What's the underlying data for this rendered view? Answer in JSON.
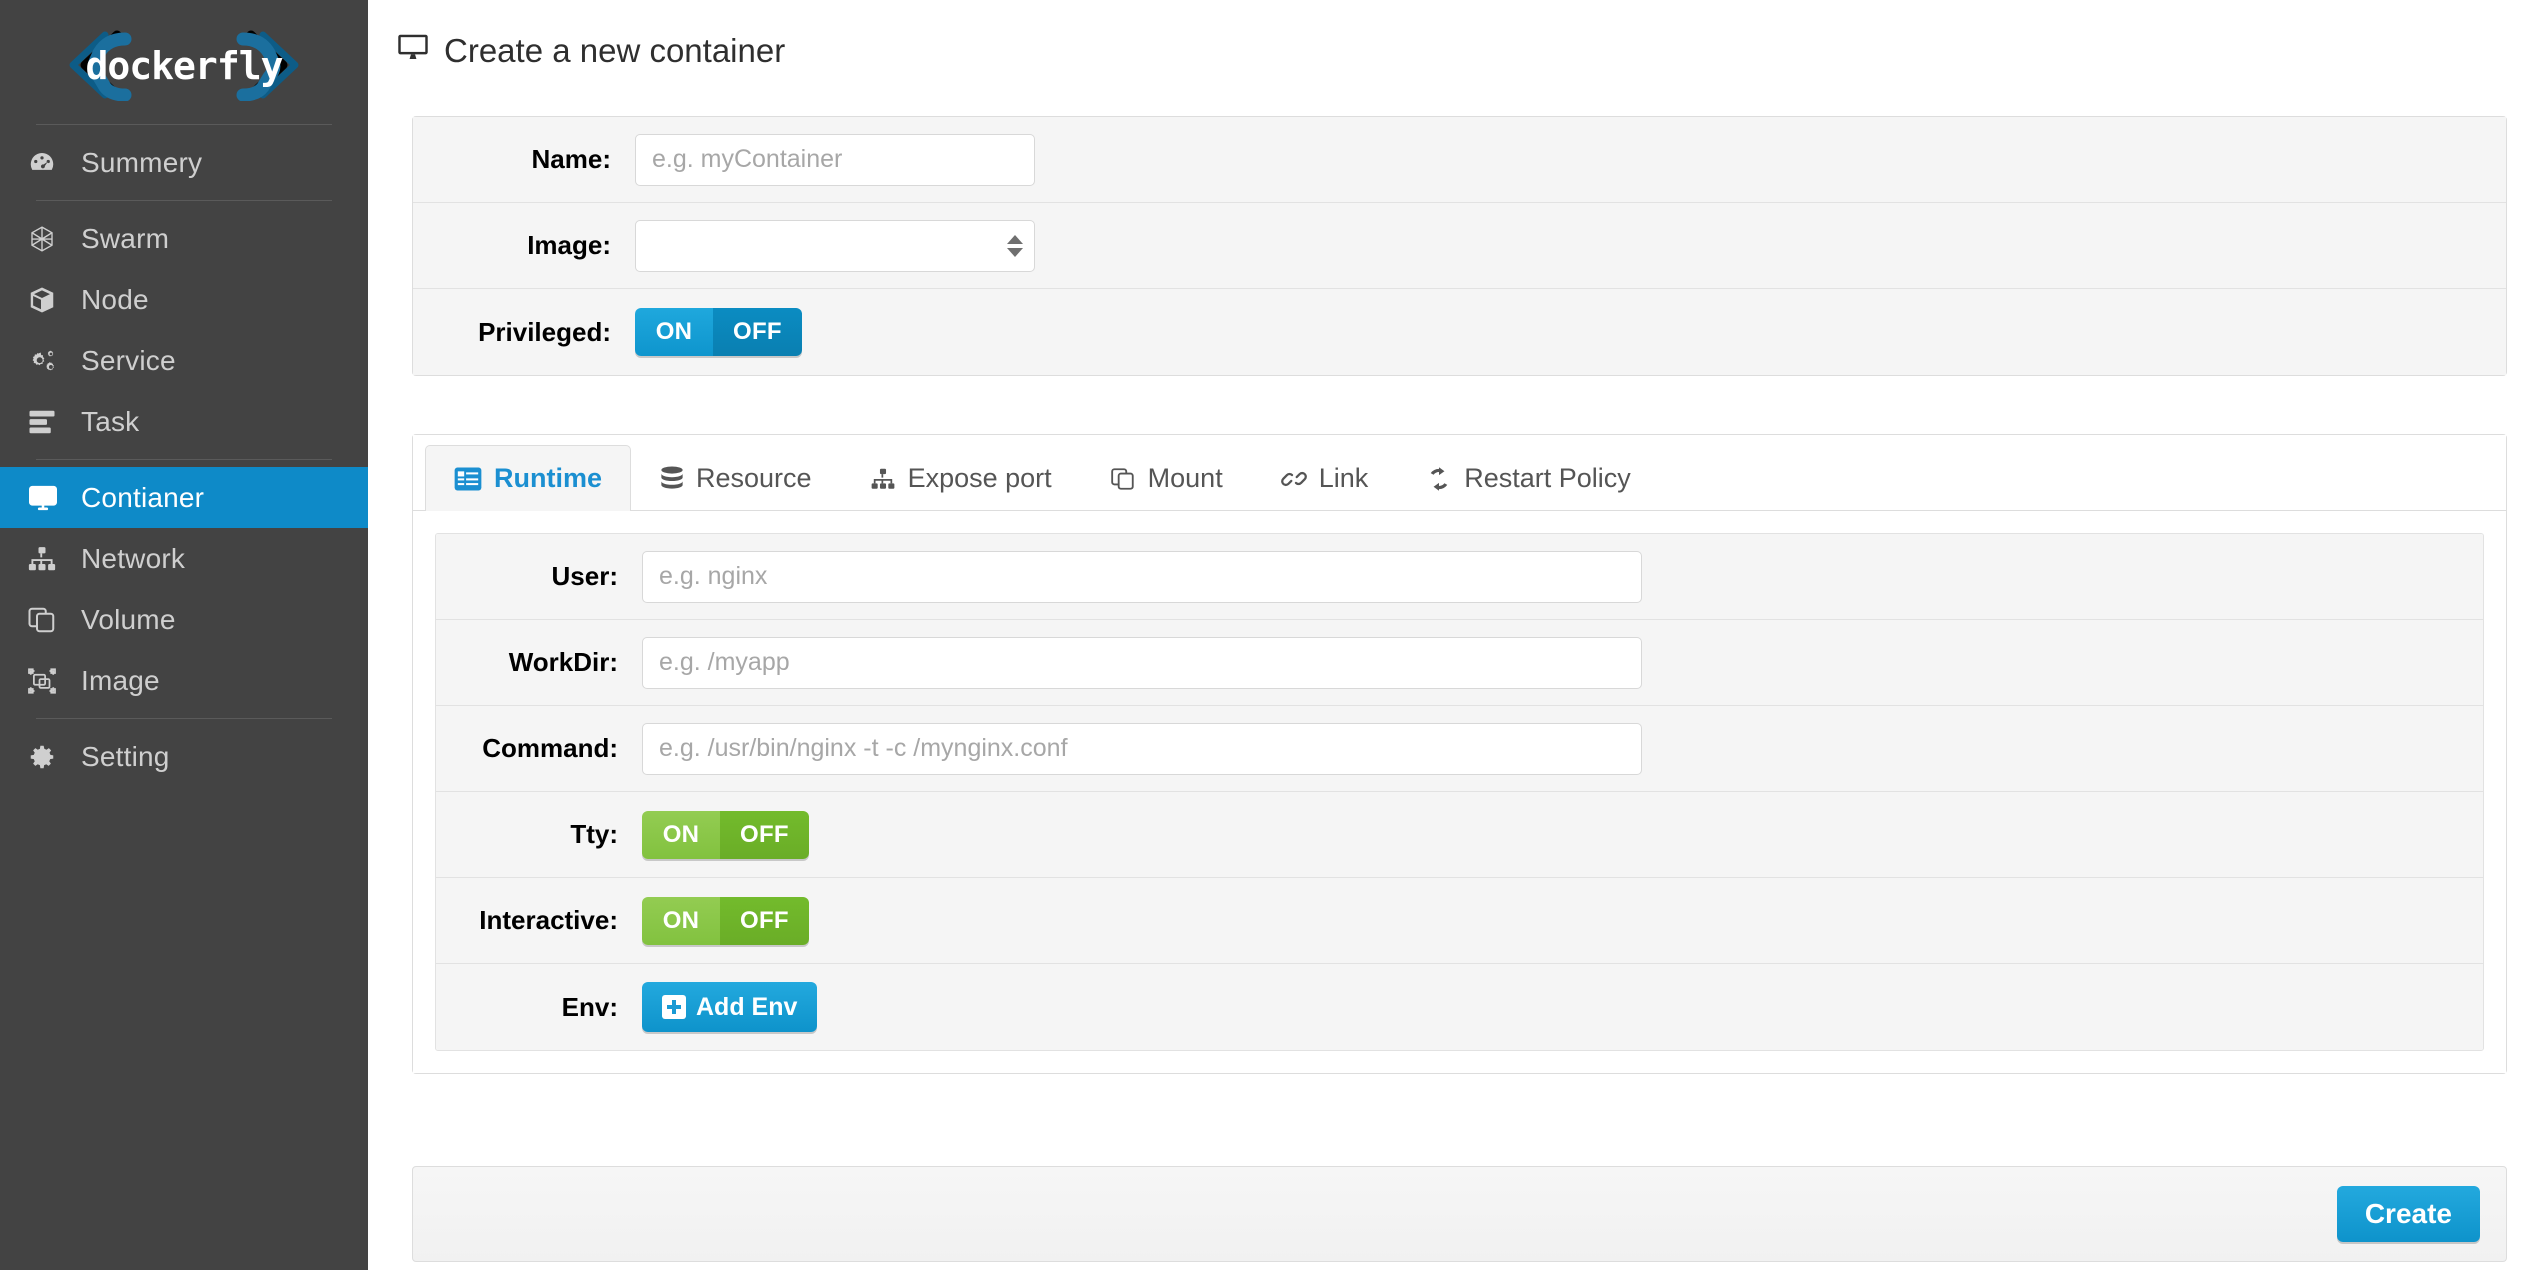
{
  "brand": {
    "name": "dockerfly"
  },
  "sidebar": {
    "items": [
      {
        "label": "Summery",
        "icon": "dashboard-icon",
        "active": false
      },
      {
        "label": "Swarm",
        "icon": "swarm-hexagon-icon",
        "active": false
      },
      {
        "label": "Node",
        "icon": "cube-icon",
        "active": false
      },
      {
        "label": "Service",
        "icon": "gears-icon",
        "active": false
      },
      {
        "label": "Task",
        "icon": "tasks-list-icon",
        "active": false
      },
      {
        "label": "Contianer",
        "icon": "monitor-icon",
        "active": true
      },
      {
        "label": "Network",
        "icon": "sitemap-icon",
        "active": false
      },
      {
        "label": "Volume",
        "icon": "copy-icon",
        "active": false
      },
      {
        "label": "Image",
        "icon": "image-frame-icon",
        "active": false
      },
      {
        "label": "Setting",
        "icon": "gear-icon",
        "active": false
      }
    ]
  },
  "page": {
    "title": "Create a new container",
    "title_icon": "monitor-icon"
  },
  "basic_form": {
    "name": {
      "label": "Name:",
      "value": "",
      "placeholder": "e.g. myContainer"
    },
    "image": {
      "label": "Image:",
      "value": "",
      "options": []
    },
    "privileged": {
      "label": "Privileged:",
      "on_label": "ON",
      "off_label": "OFF",
      "selected": "ON"
    }
  },
  "tabs": [
    {
      "label": "Runtime",
      "icon": "list-alt-icon",
      "active": true
    },
    {
      "label": "Resource",
      "icon": "database-icon",
      "active": false
    },
    {
      "label": "Expose port",
      "icon": "sitemap-icon",
      "active": false
    },
    {
      "label": "Mount",
      "icon": "copy-icon",
      "active": false
    },
    {
      "label": "Link",
      "icon": "chain-icon",
      "active": false
    },
    {
      "label": "Restart Policy",
      "icon": "refresh-icon",
      "active": false
    }
  ],
  "runtime_form": {
    "user": {
      "label": "User:",
      "value": "",
      "placeholder": "e.g. nginx"
    },
    "workdir": {
      "label": "WorkDir:",
      "value": "",
      "placeholder": "e.g. /myapp"
    },
    "command": {
      "label": "Command:",
      "value": "",
      "placeholder": "e.g. /usr/bin/nginx -t -c /mynginx.conf"
    },
    "tty": {
      "label": "Tty:",
      "on_label": "ON",
      "off_label": "OFF",
      "selected": "ON"
    },
    "interactive": {
      "label": "Interactive:",
      "on_label": "ON",
      "off_label": "OFF",
      "selected": "ON"
    },
    "env": {
      "label": "Env:",
      "add_label": "Add Env",
      "add_icon": "plus-square-icon"
    }
  },
  "footer": {
    "create_label": "Create"
  },
  "colors": {
    "sidebar_bg": "#434343",
    "active_nav": "#0e8ac8",
    "accent_blue": "#1a9ad4",
    "toggle_green": "#82c23f",
    "panel_row_bg": "#f5f5f5"
  }
}
